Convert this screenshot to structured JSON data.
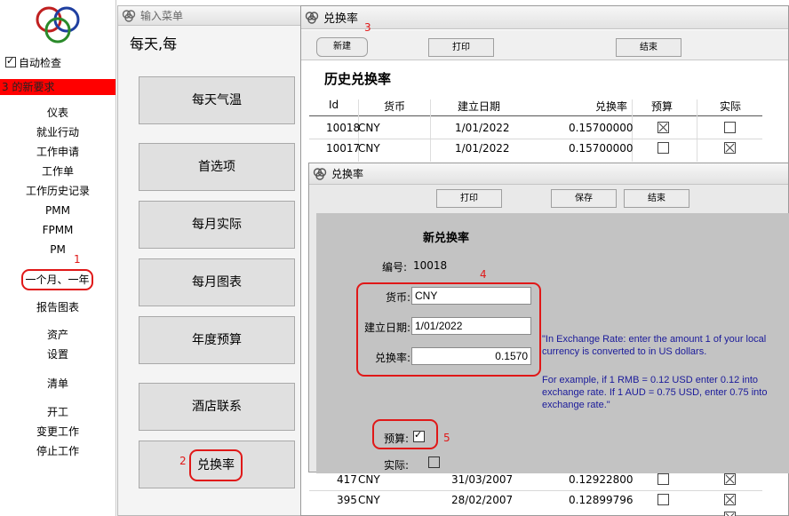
{
  "sidebar": {
    "auto_check_label": "自动检查",
    "new_request_text": "3 的新要求",
    "items": [
      {
        "label": "仪表"
      },
      {
        "label": "就业行动"
      },
      {
        "label": "工作申请"
      },
      {
        "label": "工作单"
      },
      {
        "label": "工作历史记录"
      },
      {
        "label": "PMM"
      },
      {
        "label": "FPMM"
      },
      {
        "label": "PM"
      },
      {
        "label": "一个月、一年"
      },
      {
        "label": "报告图表"
      },
      {
        "label": "资产"
      },
      {
        "label": "设置"
      },
      {
        "label": "清单"
      },
      {
        "label": "开工"
      },
      {
        "label": "变更工作"
      },
      {
        "label": "停止工作"
      }
    ]
  },
  "input_menu": {
    "title": "输入菜单",
    "banner": "每天,每",
    "buttons": [
      {
        "label": "每天气温"
      },
      {
        "label": "首选项"
      },
      {
        "label": "每月实际"
      },
      {
        "label": "每月图表"
      },
      {
        "label": "年度预算"
      },
      {
        "label": "酒店联系"
      },
      {
        "label": "兑换率"
      }
    ]
  },
  "rate_window": {
    "title": "兑换率",
    "toolbar": {
      "new_label": "新建",
      "print_label": "打印",
      "end_label": "结束"
    },
    "section_title": "历史兑换率",
    "columns": [
      "Id",
      "货币",
      "建立日期",
      "兑换率",
      "预算",
      "实际"
    ],
    "rows_top": [
      {
        "id": "10018",
        "currency": "CNY",
        "date": "1/01/2022",
        "rate": "0.15700000",
        "budget": true,
        "actual": false
      },
      {
        "id": "10017",
        "currency": "CNY",
        "date": "1/01/2022",
        "rate": "0.15700000",
        "budget": false,
        "actual": true
      }
    ],
    "rows_bottom": [
      {
        "id": "417",
        "currency": "CNY",
        "date": "31/03/2007",
        "rate": "0.12922800",
        "budget": false,
        "actual": true
      },
      {
        "id": "395",
        "currency": "CNY",
        "date": "28/02/2007",
        "rate": "0.12899796",
        "budget": false,
        "actual": true
      }
    ]
  },
  "new_rate_dialog": {
    "title": "兑换率",
    "toolbar": {
      "print_label": "打印",
      "save_label": "保存",
      "end_label": "结束"
    },
    "heading": "新兑换率",
    "number_label": "编号:",
    "number_value": "10018",
    "currency_label": "货币:",
    "currency_value": "CNY",
    "date_label": "建立日期:",
    "date_value": "1/01/2022",
    "rate_label": "兑换率:",
    "rate_value": "0.1570",
    "budget_label": "预算:",
    "budget_checked": true,
    "actual_label": "实际:",
    "actual_checked": false,
    "note_1": "\"In Exchange Rate: enter the amount 1 of your local currency is converted to in US dollars.",
    "note_2": "For example, if 1 RMB = 0.12 USD enter 0.12 into exchange rate.  If 1 AUD = 0.75  USD, enter 0.75 into exchange rate.\""
  },
  "annotations": {
    "one": "1",
    "two": "2",
    "three": "3",
    "four": "4",
    "five": "5"
  },
  "colors": {
    "annotation_red": "#e01818",
    "new_request_bg": "#ff0000",
    "note_blue": "#1a1a9a"
  }
}
